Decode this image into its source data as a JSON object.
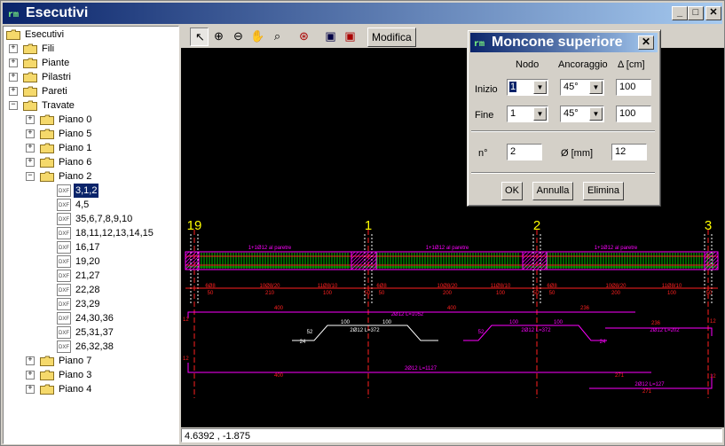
{
  "window": {
    "title": "Esecutivi"
  },
  "tree": {
    "root": "Esecutivi",
    "top": [
      "Fili",
      "Piante",
      "Pilastri",
      "Pareti",
      "Travate"
    ],
    "floors_before": [
      "Piano 0",
      "Piano 5",
      "Piano 1",
      "Piano 6",
      "Piano 2"
    ],
    "files": [
      "3,1,2",
      "4,5",
      "35,6,7,8,9,10",
      "18,11,12,13,14,15",
      "16,17",
      "19,20",
      "21,27",
      "22,28",
      "23,29",
      "24,30,36",
      "25,31,37",
      "26,32,38"
    ],
    "file_icon_text": "DXF",
    "floors_after": [
      "Piano 7",
      "Piano 3",
      "Piano 4"
    ]
  },
  "toolbar": {
    "icons": [
      "pointer-icon",
      "zoom-in-icon",
      "zoom-out-icon",
      "pan-hand-icon",
      "zoom-window-icon",
      "zoom-extents-icon",
      "save-icon",
      "save-as-icon"
    ],
    "modify_label": "Modifica"
  },
  "status": {
    "coords": "4.6392 , -1.875"
  },
  "dialog": {
    "title": "Moncone superiore",
    "col_nodo": "Nodo",
    "col_ancoraggio": "Ancoraggio",
    "col_delta": "Δ [cm]",
    "row_inizio": "Inizio",
    "row_fine": "Fine",
    "inizio_nodo": "1",
    "inizio_anc": "45°",
    "inizio_delta": "100",
    "fine_nodo": "1",
    "fine_anc": "45°",
    "fine_delta": "100",
    "n_label": "n°",
    "n_value": "2",
    "diam_label": "Ø [mm]",
    "diam_value": "12",
    "ok": "OK",
    "annulla": "Annulla",
    "elimina": "Elimina"
  },
  "drawing": {
    "nodes": [
      "19",
      "1",
      "2",
      "3"
    ],
    "top_labels": [
      "1+1Ø12 al paretre",
      "1+1Ø12 al paretre",
      "1+1Ø12 al paretre"
    ],
    "stirrup_labels": [
      "6Ø8",
      "10Ø8/20",
      "11Ø8/10",
      "6Ø8",
      "10Ø8/20",
      "11Ø8/10",
      "6Ø8",
      "10Ø8/20",
      "11Ø8/10"
    ],
    "dim_values": [
      "50",
      "210",
      "100",
      "50",
      "50",
      "200",
      "100",
      "50",
      "50",
      "200",
      "100",
      "50"
    ],
    "bar1_label": "2Ø12 L=1052",
    "bar1_seg1": "400",
    "bar1_seg2": "400",
    "bar1_seg3": "236",
    "bar2_label": "2Ø12 L=372",
    "bar2_top_a": "100",
    "bar2_top_b": "100",
    "bar2_diag": "52",
    "bar2_end": "24",
    "bar3_label": "2Ø12 L=372",
    "bar3_top_a": "100",
    "bar3_top_b": "100",
    "bar3_diag": "52",
    "bar3_end": "24",
    "bar4_label": "2Ø12 L=202",
    "bar4_seg": "236",
    "bar5_label": "2Ø12 L=1127",
    "bar5_seg1": "400",
    "bar5_seg2": "271",
    "bar6_label": "2Ø12 L=127",
    "bar6_seg": "271",
    "end_marks": [
      "12",
      "12",
      "12",
      "12"
    ]
  }
}
